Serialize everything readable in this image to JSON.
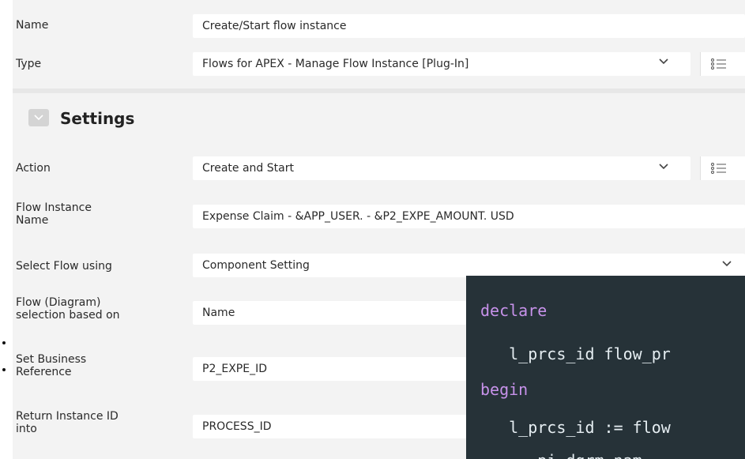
{
  "form": {
    "name_label": "Name",
    "name_value": "Create/Start flow instance",
    "type_label": "Type",
    "type_value": "Flows for APEX - Manage Flow Instance [Plug-In]"
  },
  "settings": {
    "title": "Settings",
    "action_label": "Action",
    "action_value": "Create and Start",
    "flow_instance_name_label_line1": "Flow Instance",
    "flow_instance_name_label_line2": "Name",
    "flow_instance_name_value": "Expense Claim - &APP_USER. - &P2_EXPE_AMOUNT. USD",
    "select_flow_label": "Select Flow using",
    "select_flow_value": "Component Setting",
    "flow_diagram_label_line1": "Flow (Diagram)",
    "flow_diagram_label_line2": "selection based on",
    "flow_diagram_value": "Name",
    "business_ref_label_line1": "Set Business",
    "business_ref_label_line2": "Reference",
    "business_ref_value": "P2_EXPE_ID",
    "return_instance_label_line1": "Return Instance ID",
    "return_instance_label_line2": "into",
    "return_instance_value": "PROCESS_ID"
  },
  "code": {
    "line1": "declare",
    "line2": "   l_prcs_id flow_pr",
    "line3": "begin",
    "line4": "   l_prcs_id := flow",
    "line5": "      pi_dgrm_nam"
  },
  "icons": {
    "chevron": "chevron-down-icon",
    "list": "list-icon",
    "collapse": "collapse-icon"
  },
  "colors": {
    "accent_orange": "#f08a24",
    "code_bg": "#263238",
    "keyword": "#c792ea"
  }
}
